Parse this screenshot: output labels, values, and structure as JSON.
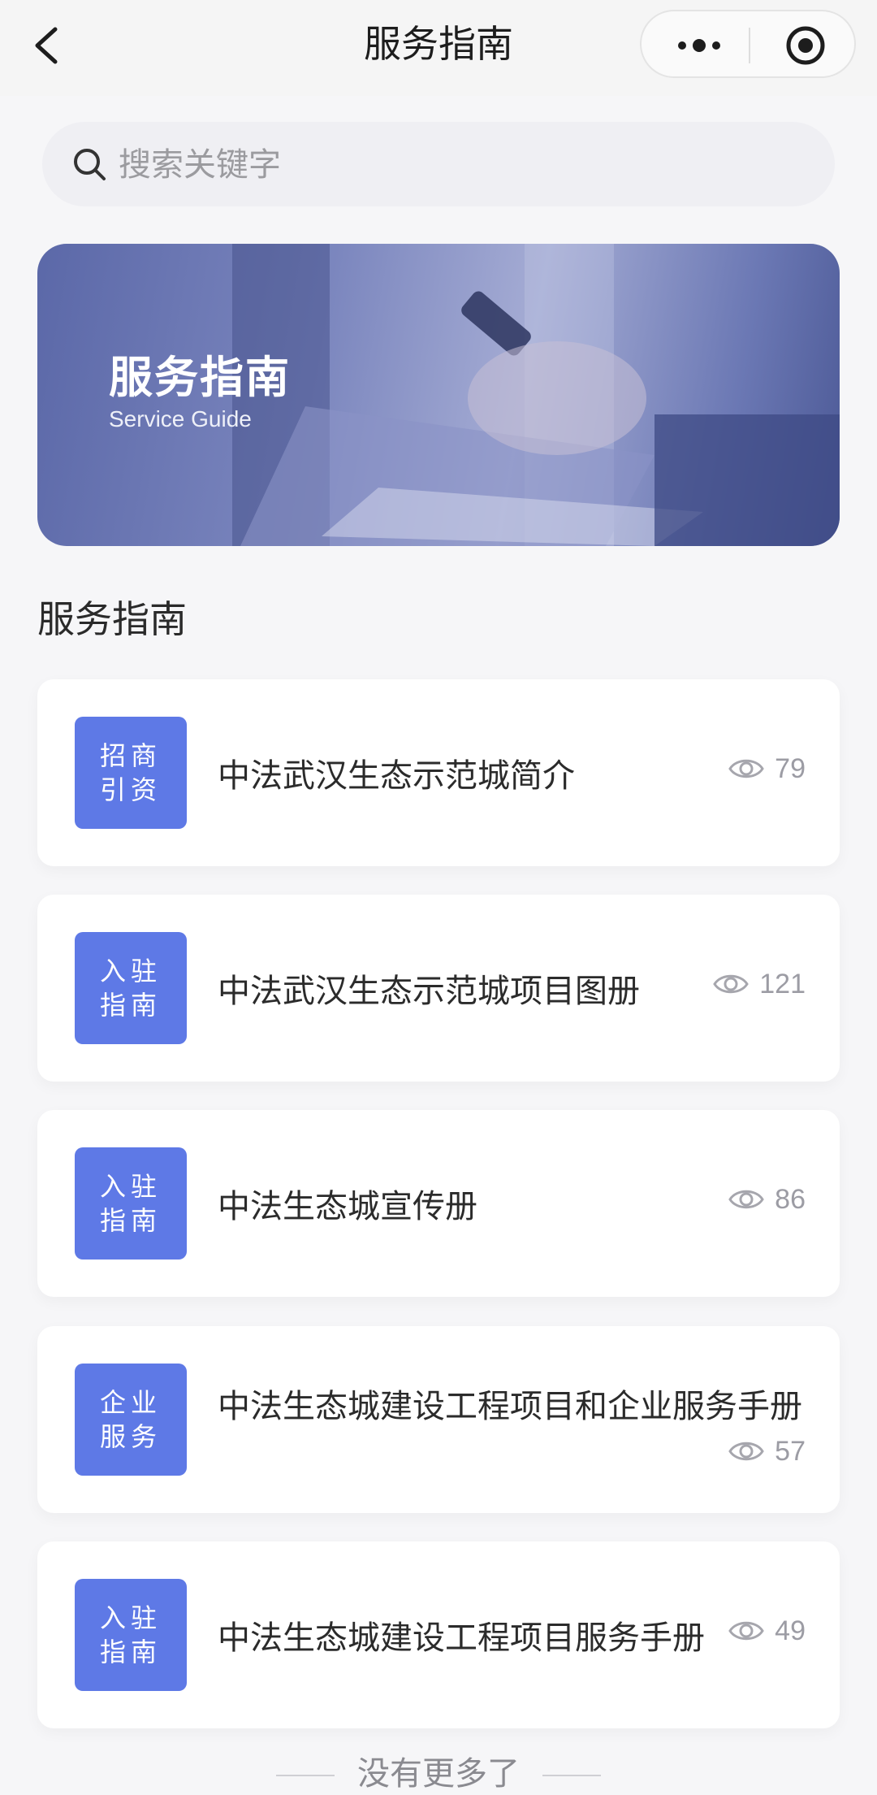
{
  "nav": {
    "title": "服务指南"
  },
  "search": {
    "placeholder": "搜索关键字"
  },
  "banner": {
    "title": "服务指南",
    "subtitle": "Service Guide"
  },
  "section": {
    "title": "服务指南"
  },
  "items": [
    {
      "tag_line1": "招商",
      "tag_line2": "引资",
      "title": "中法武汉生态示范城简介",
      "views": "79"
    },
    {
      "tag_line1": "入驻",
      "tag_line2": "指南",
      "title": "中法武汉生态示范城项目图册",
      "views": "121"
    },
    {
      "tag_line1": "入驻",
      "tag_line2": "指南",
      "title": "中法生态城宣传册",
      "views": "86"
    },
    {
      "tag_line1": "企业",
      "tag_line2": "服务",
      "title": "中法生态城建设工程项目和企业服务手册",
      "views": "57"
    },
    {
      "tag_line1": "入驻",
      "tag_line2": "指南",
      "title": "中法生态城建设工程项目服务手册",
      "views": "49"
    }
  ],
  "footer": {
    "text": "没有更多了"
  },
  "colors": {
    "tag_bg": "#5e79e6",
    "page_bg": "#f6f6f8"
  }
}
